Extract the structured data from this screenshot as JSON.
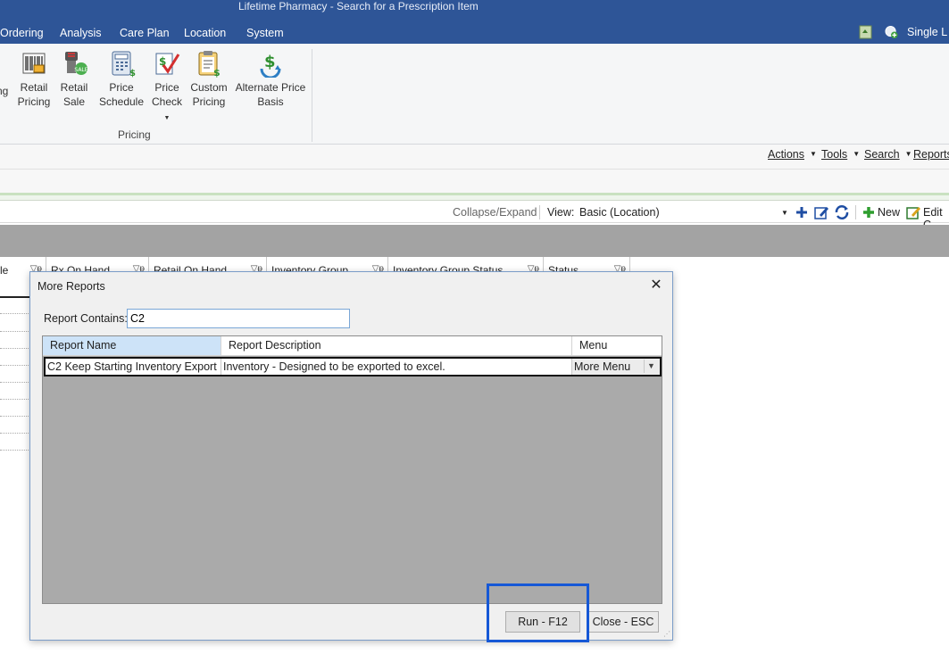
{
  "window": {
    "title": "Lifetime Pharmacy - Search for a Prescription Item"
  },
  "menu": {
    "items": [
      "Ordering",
      "Analysis",
      "Care Plan",
      "Location",
      "System"
    ],
    "right_label": "Single L"
  },
  "ribbon": {
    "partial_label": "ng",
    "buttons": [
      {
        "line1": "Retail",
        "line2": "Pricing",
        "icon": "barcode-icon"
      },
      {
        "line1": "Retail",
        "line2": "Sale",
        "icon": "sale-scanner-icon"
      },
      {
        "line1": "Price",
        "line2": "Schedule",
        "icon": "calculator-icon"
      },
      {
        "line1": "Price",
        "line2": "Check",
        "icon": "price-check-icon"
      },
      {
        "line1": "Custom",
        "line2": "Pricing",
        "icon": "clipboard-dollar-icon"
      },
      {
        "line1": "Alternate Price",
        "line2": "Basis",
        "icon": "dollar-refresh-icon"
      }
    ],
    "group_label": "Pricing"
  },
  "actions": {
    "actions": "Actions",
    "tools": "Tools",
    "search": "Search",
    "reports": "Reports"
  },
  "view_toolbar": {
    "collapse_expand": "Collapse/Expand",
    "view_label": "View:",
    "view_value": "Basic (Location)",
    "new_label": "New",
    "edit_label": "Edit C"
  },
  "background_grid": {
    "columns": [
      "le",
      "Rx On Hand",
      "Retail On Hand",
      "Inventory Group",
      "Inventory Group Status",
      "Status"
    ]
  },
  "dialog": {
    "title": "More Reports",
    "close_glyph": "✕",
    "filter_label": "Report Contains:",
    "filter_value": "C2",
    "columns": [
      "Report Name",
      "Report Description",
      "Menu"
    ],
    "rows": [
      {
        "name": "C2 Keep Starting Inventory Export",
        "description": "Inventory - Designed to be exported to excel.",
        "menu": "More Menu"
      }
    ],
    "run_button": "Run - F12",
    "close_button": "Close - ESC"
  },
  "colors": {
    "title_bar": "#2e5597",
    "highlight": "#1658d6",
    "grid_bg": "#aaaaaa"
  }
}
